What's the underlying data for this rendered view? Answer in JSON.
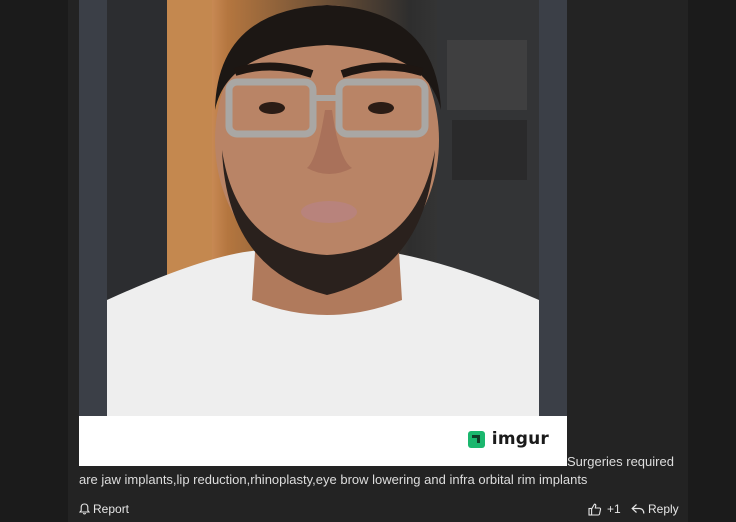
{
  "comment": {
    "text_line1": "Surgeries required",
    "text_line2": "are jaw implants,lip reduction,rhinoplasty,eye brow lowering and infra orbital rim implants"
  },
  "embed": {
    "brand": "imgur",
    "brand_color": "#1bb76e"
  },
  "actions": {
    "report_label": "Report",
    "vote_count": "+1",
    "reply_label": "Reply"
  },
  "icons": {
    "report": "bell-icon",
    "upvote": "thumbs-up-icon",
    "reply": "reply-arrow-icon",
    "brand": "imgur-logo-icon"
  }
}
